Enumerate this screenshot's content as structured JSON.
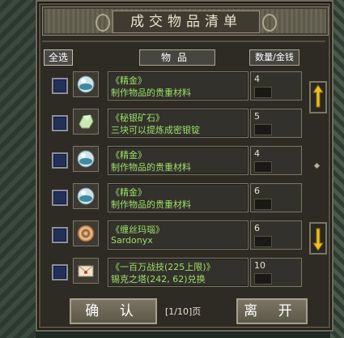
{
  "window": {
    "title": "成交物品清单",
    "select_all_label": "全选",
    "items_header": "物品",
    "qty_header": "数量/金钱",
    "page_indicator": "[1/10]页",
    "confirm_label": "确 认",
    "leave_label": "离 开"
  },
  "items": [
    {
      "icon": "orb-icon",
      "line1": "《精金》",
      "line2": "制作物品的贵重材料",
      "qty": "4"
    },
    {
      "icon": "ore-icon",
      "line1": "《秘银矿石》",
      "line2": "三块可以提炼成密银锭",
      "qty": "5"
    },
    {
      "icon": "orb-icon",
      "line1": "《精金》",
      "line2": "制作物品的贵重材料",
      "qty": "4"
    },
    {
      "icon": "orb-icon",
      "line1": "《精金》",
      "line2": "制作物品的贵重材料",
      "qty": "6"
    },
    {
      "icon": "agate-icon",
      "line1": "《缠丝玛瑙》",
      "line2": "Sardonyx",
      "qty": "6"
    },
    {
      "icon": "letter-icon",
      "line1": "《一百万战技(225上限)》",
      "line2": "锡克之塔(242, 62)兑换",
      "qty": "10"
    }
  ],
  "colors": {
    "item_text": "#9be06a",
    "panel": "#2e2b25",
    "checkbox_fill": "#23315a"
  }
}
